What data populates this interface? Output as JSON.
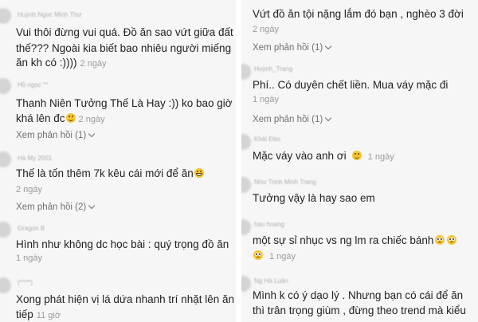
{
  "left": {
    "comments": [
      {
        "user": "Huỳnh Ngọc Minh Thư",
        "text_lines": [
          "Vui thôi đừng vui quá. Đồ ăn sao vứt giữa đất",
          "thế??? Ngoài kia biết bao nhiêu người miếng",
          "ăn kh có :))))"
        ],
        "time": "2 ngày"
      },
      {
        "user": "Hồ ngọc **",
        "text_lines": [
          "Thanh Niên Tưởng Thế Là Hay :)) ko bao giờ",
          "khá lên đc"
        ],
        "time": "2 ngày",
        "replies": "Xem phản hồi (1)"
      },
      {
        "user": "Hà My 2001",
        "text_lines": [
          "Thế là tốn thêm 7k kêu cái mới để ăn"
        ],
        "time": "2 ngày",
        "replies": "Xem phản hồi (2)"
      },
      {
        "user": "Gragon B",
        "text_lines": [
          "Hình như không dc học bài : quý trọng đồ ăn"
        ],
        "time": "1 ngày"
      },
      {
        "user": "(*^^*)",
        "text_lines": [
          "Xong phát hiện vị lá dứa nhanh trí nhặt lên ăn",
          "tiếp"
        ],
        "time": "11 giờ"
      }
    ]
  },
  "right": {
    "comments": [
      {
        "user": "",
        "text_lines": [
          "Vứt đồ ăn tội nặng lắm đó bạn , nghèo 3 đời"
        ],
        "time": "2 ngày",
        "replies": "Xem phản hồi (1)"
      },
      {
        "user": "Huỳnh_Trang",
        "text_lines": [
          "Phí.. Có duyên chết liền. Mua váy mặc đi"
        ],
        "time": "1 ngày",
        "replies": "Xem phản hồi (1)"
      },
      {
        "user": "Khải Đào",
        "text_lines": [
          "Mặc váy vào anh ơi"
        ],
        "time": "1 ngày"
      },
      {
        "user": "Như Trịnh Minh Trang",
        "text_lines": [
          "Tưởng vậy là hay sao em"
        ],
        "time": ""
      },
      {
        "user": "hau hoang",
        "text_lines": [
          "một sự sỉ nhục vs ng lm ra chiếc bánh"
        ],
        "time": "1 ngày"
      },
      {
        "user": "Ng Hà Luân",
        "text_lines": [
          "Mình k có ý dạo lý . Nhưng bạn có cái để ăn",
          "thì trân trọng giùm , đừng theo trend mà kiểu"
        ],
        "time": ""
      }
    ]
  }
}
